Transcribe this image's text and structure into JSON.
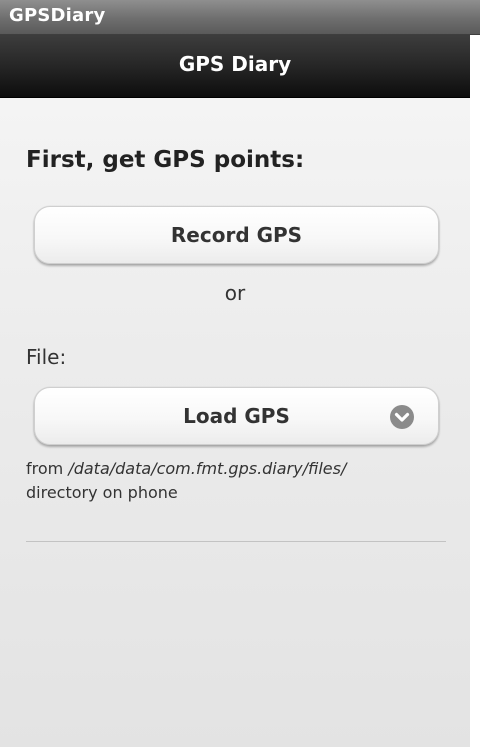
{
  "window": {
    "title": "GPSDiary"
  },
  "header": {
    "title": "GPS Diary"
  },
  "main": {
    "heading": "First, get GPS points:",
    "record_button_label": "Record GPS",
    "or_text": "or",
    "file_label": "File:",
    "load_button_label": "Load GPS",
    "load_dropdown_icon": "chevron-down-icon",
    "hint_prefix": "from ",
    "hint_path": "/data/data/com.fmt.gps.diary/files/",
    "hint_suffix": "directory on phone"
  },
  "colors": {
    "header_background": "#1a1a1a",
    "content_background": "#ebebeb",
    "button_text": "#333333",
    "title_bar": "#6e6e6e"
  }
}
